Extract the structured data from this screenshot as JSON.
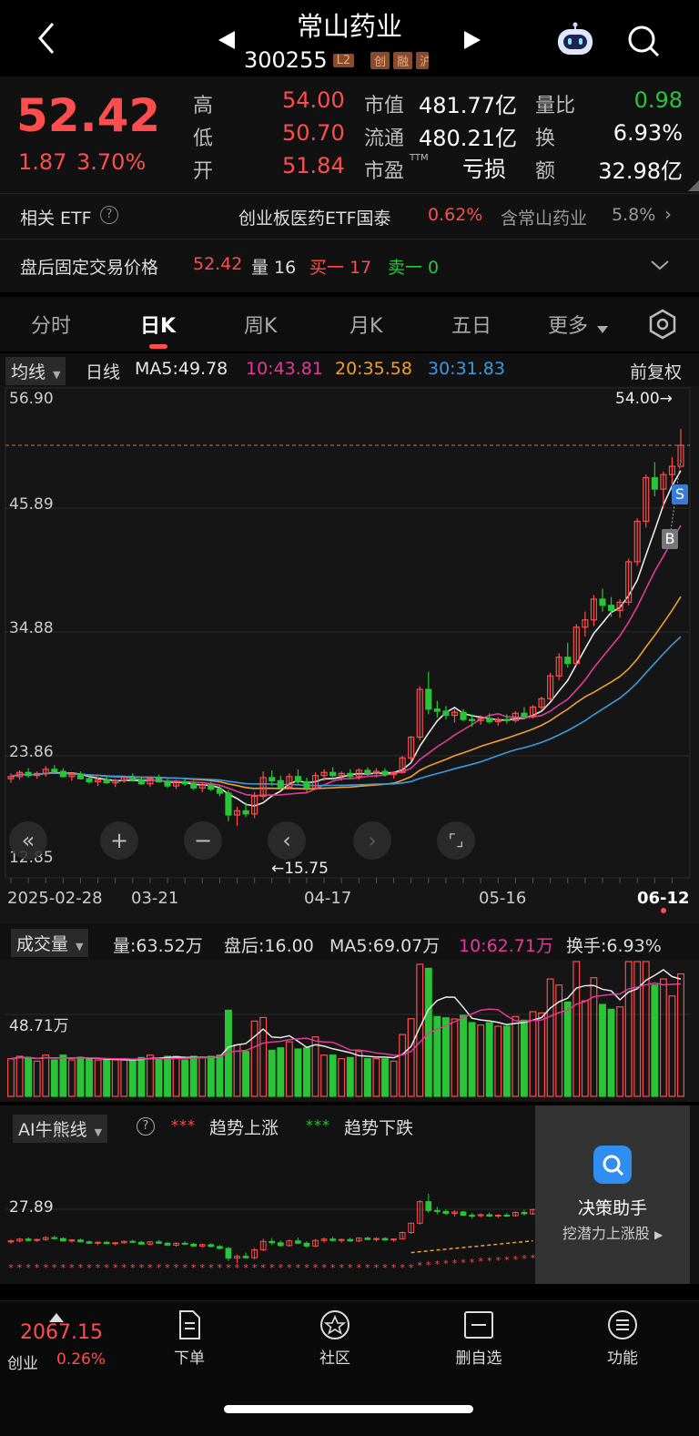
{
  "header": {
    "title": "常山药业",
    "code": "300255",
    "badges": [
      "L2",
      "创",
      "融",
      "沪"
    ]
  },
  "quote": {
    "price": "52.42",
    "change": "1.87",
    "change_pct": "3.70%",
    "high_label": "高",
    "high": "54.00",
    "low_label": "低",
    "low": "50.70",
    "open_label": "开",
    "open": "51.84",
    "mcap_label": "市值",
    "mcap": "481.77亿",
    "float_label": "流通",
    "float": "480.21亿",
    "pe_label": "市盈",
    "pe_sup": "TTM",
    "pe": "亏损",
    "vratio_label": "量比",
    "vratio": "0.98",
    "turnover_label": "换",
    "turnover": "6.93%",
    "amount_label": "额",
    "amount": "32.98亿"
  },
  "etf": {
    "label": "相关 ETF",
    "name": "创业板医药ETF国泰",
    "pct": "0.62%",
    "holding_label": "含常山药业",
    "holding_pct": "5.8%"
  },
  "after_hours": {
    "label": "盘后固定交易价格",
    "price": "52.42",
    "vol": "量 16",
    "buy1": "买一 17",
    "sell1": "卖一 0"
  },
  "tabs": [
    "分时",
    "日K",
    "周K",
    "月K",
    "五日",
    "更多"
  ],
  "ma": {
    "selector": "均线",
    "period": "日线",
    "ma5": "MA5:49.78",
    "ma10": "10:43.81",
    "ma20": "20:35.58",
    "ma30": "30:31.83",
    "adjust": "前复权"
  },
  "kchart": {
    "y_labels": [
      "56.90",
      "45.89",
      "34.88",
      "23.86",
      "12.85"
    ],
    "high_marker": "54.00→",
    "low_marker": "←15.75",
    "x_labels": [
      "2025-02-28",
      "03-21",
      "04-17",
      "05-16",
      "06-12"
    ],
    "sell_marker": "S",
    "buy_marker": "B"
  },
  "volume": {
    "selector": "成交量",
    "vol": "量:63.52万",
    "after": "盘后:16.00",
    "ma5": "MA5:69.07万",
    "ma10": "10:62.71万",
    "turnover": "换手:6.93%",
    "y_label": "48.71万"
  },
  "ai": {
    "selector": "AI牛熊线",
    "up_label": "趋势上涨",
    "down_label": "趋势下跌",
    "y_label": "27.89",
    "assist_title": "决策助手",
    "assist_sub": "挖潜力上涨股"
  },
  "bottom": {
    "index_value": "2067.15",
    "index_name": "创业",
    "index_pct": "0.26%",
    "nav": [
      "下单",
      "社区",
      "删自选",
      "功能"
    ]
  },
  "colors": {
    "up": "#ff4d4d",
    "down": "#29c537",
    "ma5": "#e8e8e8",
    "ma10": "#e23a9c",
    "ma20": "#f0a030",
    "ma30": "#3a9ce0"
  },
  "chart_data": {
    "type": "candlestick",
    "ylim": [
      12.85,
      56.9
    ],
    "ohlc": [
      [
        20.3,
        20.8,
        19.9,
        20.5
      ],
      [
        20.5,
        21.1,
        20.2,
        20.9
      ],
      [
        20.9,
        21.3,
        20.4,
        20.6
      ],
      [
        20.6,
        21.0,
        20.3,
        20.8
      ],
      [
        20.8,
        21.5,
        20.5,
        21.2
      ],
      [
        21.2,
        21.6,
        20.8,
        21.0
      ],
      [
        21.0,
        21.3,
        20.4,
        20.5
      ],
      [
        20.5,
        20.9,
        20.1,
        20.7
      ],
      [
        20.7,
        21.0,
        20.2,
        20.3
      ],
      [
        20.3,
        20.6,
        19.8,
        20.0
      ],
      [
        20.0,
        20.4,
        19.6,
        20.2
      ],
      [
        20.2,
        20.5,
        19.8,
        19.9
      ],
      [
        19.9,
        20.3,
        19.5,
        20.1
      ],
      [
        20.1,
        20.6,
        19.9,
        20.4
      ],
      [
        20.4,
        20.8,
        20.0,
        20.2
      ],
      [
        20.2,
        20.5,
        19.7,
        19.8
      ],
      [
        19.8,
        20.4,
        19.5,
        20.3
      ],
      [
        20.3,
        20.7,
        19.9,
        20.0
      ],
      [
        20.0,
        20.3,
        19.4,
        19.6
      ],
      [
        19.6,
        20.2,
        19.3,
        20.0
      ],
      [
        20.0,
        20.4,
        19.6,
        19.8
      ],
      [
        19.8,
        20.1,
        19.2,
        19.4
      ],
      [
        19.4,
        19.9,
        19.0,
        19.7
      ],
      [
        19.7,
        20.0,
        19.1,
        19.3
      ],
      [
        19.3,
        19.6,
        18.6,
        18.9
      ],
      [
        18.9,
        19.2,
        16.2,
        16.8
      ],
      [
        16.8,
        17.6,
        15.75,
        17.2
      ],
      [
        17.2,
        18.0,
        16.6,
        16.9
      ],
      [
        16.9,
        19.0,
        16.5,
        18.6
      ],
      [
        18.6,
        21.0,
        18.3,
        20.4
      ],
      [
        20.4,
        21.1,
        19.6,
        20.1
      ],
      [
        20.1,
        20.6,
        19.2,
        19.5
      ],
      [
        19.5,
        20.8,
        19.3,
        20.5
      ],
      [
        20.5,
        21.2,
        19.8,
        20.0
      ],
      [
        20.0,
        20.4,
        19.0,
        19.4
      ],
      [
        19.4,
        20.9,
        19.2,
        20.6
      ],
      [
        20.6,
        21.2,
        20.1,
        20.9
      ],
      [
        20.9,
        21.4,
        20.3,
        20.6
      ],
      [
        20.6,
        21.0,
        20.1,
        20.8
      ],
      [
        20.8,
        21.2,
        20.3,
        20.5
      ],
      [
        20.5,
        21.3,
        20.2,
        21.1
      ],
      [
        21.1,
        21.4,
        20.6,
        20.8
      ],
      [
        20.8,
        21.3,
        20.4,
        21.0
      ],
      [
        21.0,
        21.3,
        20.5,
        20.7
      ],
      [
        20.7,
        21.0,
        20.3,
        20.9
      ],
      [
        20.9,
        22.5,
        20.8,
        22.3
      ],
      [
        22.3,
        24.4,
        22.0,
        24.3
      ],
      [
        24.3,
        29.2,
        24.0,
        28.9
      ],
      [
        28.9,
        30.6,
        26.5,
        27.0
      ],
      [
        27.0,
        27.8,
        26.2,
        26.8
      ],
      [
        26.8,
        27.3,
        26.0,
        26.4
      ],
      [
        26.4,
        27.0,
        25.7,
        26.7
      ],
      [
        26.7,
        27.0,
        25.8,
        26.0
      ],
      [
        26.0,
        26.5,
        25.3,
        25.9
      ],
      [
        25.9,
        26.4,
        25.5,
        26.1
      ],
      [
        26.1,
        26.6,
        25.6,
        25.8
      ],
      [
        25.8,
        26.2,
        25.4,
        26.0
      ],
      [
        26.0,
        26.5,
        25.6,
        25.9
      ],
      [
        25.9,
        26.8,
        25.7,
        26.6
      ],
      [
        26.6,
        27.2,
        26.0,
        26.3
      ],
      [
        26.3,
        27.4,
        26.1,
        27.2
      ],
      [
        27.2,
        28.2,
        26.9,
        28.0
      ],
      [
        28.0,
        30.5,
        27.8,
        30.2
      ],
      [
        30.2,
        32.4,
        29.8,
        32.0
      ],
      [
        32.0,
        33.4,
        31.0,
        31.4
      ],
      [
        31.4,
        35.2,
        31.2,
        34.9
      ],
      [
        34.9,
        36.4,
        34.0,
        35.6
      ],
      [
        35.6,
        38.0,
        35.0,
        37.6
      ],
      [
        37.6,
        38.6,
        36.4,
        37.0
      ],
      [
        37.0,
        37.8,
        35.9,
        36.5
      ],
      [
        36.5,
        37.6,
        35.8,
        37.3
      ],
      [
        37.3,
        41.5,
        37.0,
        41.2
      ],
      [
        41.2,
        45.4,
        40.8,
        45.1
      ],
      [
        45.1,
        49.6,
        44.5,
        49.3
      ],
      [
        49.3,
        50.8,
        47.5,
        48.2
      ],
      [
        48.2,
        49.9,
        46.4,
        49.6
      ],
      [
        49.6,
        51.3,
        48.6,
        50.4
      ],
      [
        50.4,
        54.0,
        50.7,
        52.42
      ]
    ],
    "ma5_last": 49.78,
    "ma10_last": 43.81,
    "ma20_last": 35.58,
    "ma30_last": 31.83
  }
}
